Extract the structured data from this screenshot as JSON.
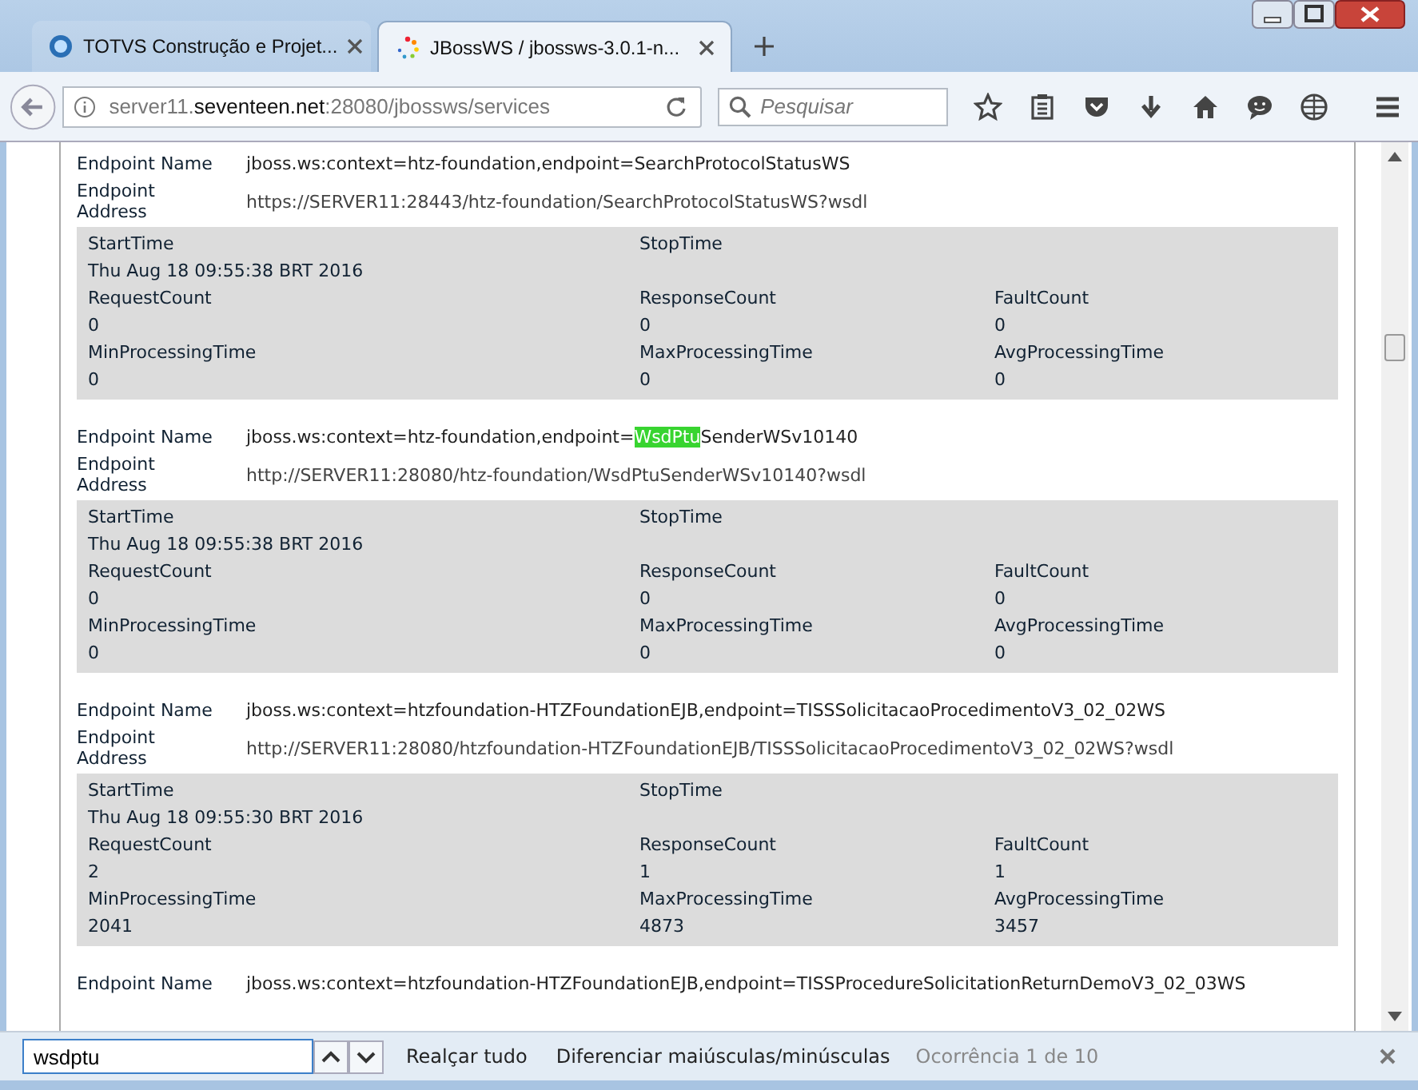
{
  "tabs": [
    {
      "label": "TOTVS Construção e Projet...",
      "selected": false
    },
    {
      "label": "JBossWS / jbossws-3.0.1-n...",
      "selected": true
    }
  ],
  "address": {
    "host_pre": "server11.",
    "host_bold": "seventeen.net",
    "rest": ":28080/jbossws/services"
  },
  "search": {
    "placeholder": "Pesquisar"
  },
  "endpoints": [
    {
      "name_label": "Endpoint Name",
      "name": [
        {
          "text": "jboss.ws:context=htz-foundation,endpoint=SearchProtocolStatusWS",
          "highlighted": false
        }
      ],
      "address_label": [
        "Endpoint",
        "Address"
      ],
      "address": "https://SERVER11:28443/htz-foundation/SearchProtocolStatusWS?wsdl",
      "stats": [
        [
          {
            "label": "StartTime",
            "value": "Thu Aug 18 09:55:38 BRT 2016"
          },
          {
            "label": "StopTime"
          }
        ],
        [
          {
            "label": "RequestCount",
            "value": "0"
          },
          {
            "label": "ResponseCount",
            "value": "0"
          },
          {
            "label": "FaultCount",
            "value": "0"
          }
        ],
        [
          {
            "label": "MinProcessingTime",
            "value": "0"
          },
          {
            "label": "MaxProcessingTime",
            "value": "0"
          },
          {
            "label": "AvgProcessingTime",
            "value": "0"
          }
        ]
      ]
    },
    {
      "name_label": "Endpoint Name",
      "name": [
        {
          "text": "jboss.ws:context=htz-foundation,endpoint=",
          "highlighted": false
        },
        {
          "text": "WsdPtu",
          "highlighted": true
        },
        {
          "text": "SenderWSv10140",
          "highlighted": false
        }
      ],
      "address_label": [
        "Endpoint",
        "Address"
      ],
      "address": "http://SERVER11:28080/htz-foundation/WsdPtuSenderWSv10140?wsdl",
      "stats": [
        [
          {
            "label": "StartTime",
            "value": "Thu Aug 18 09:55:38 BRT 2016"
          },
          {
            "label": "StopTime"
          }
        ],
        [
          {
            "label": "RequestCount",
            "value": "0"
          },
          {
            "label": "ResponseCount",
            "value": "0"
          },
          {
            "label": "FaultCount",
            "value": "0"
          }
        ],
        [
          {
            "label": "MinProcessingTime",
            "value": "0"
          },
          {
            "label": "MaxProcessingTime",
            "value": "0"
          },
          {
            "label": "AvgProcessingTime",
            "value": "0"
          }
        ]
      ]
    },
    {
      "name_label": "Endpoint Name",
      "name": [
        {
          "text": "jboss.ws:context=htzfoundation-HTZFoundationEJB,endpoint=TISSSolicitacaoProcedimentoV3_02_02WS",
          "highlighted": false
        }
      ],
      "address_label": [
        "Endpoint",
        "Address"
      ],
      "address": "http://SERVER11:28080/htzfoundation-HTZFoundationEJB/TISSSolicitacaoProcedimentoV3_02_02WS?wsdl",
      "stats": [
        [
          {
            "label": "StartTime",
            "value": "Thu Aug 18 09:55:30 BRT 2016"
          },
          {
            "label": "StopTime"
          }
        ],
        [
          {
            "label": "RequestCount",
            "value": "2"
          },
          {
            "label": "ResponseCount",
            "value": "1"
          },
          {
            "label": "FaultCount",
            "value": "1"
          }
        ],
        [
          {
            "label": "MinProcessingTime",
            "value": "2041"
          },
          {
            "label": "MaxProcessingTime",
            "value": "4873"
          },
          {
            "label": "AvgProcessingTime",
            "value": "3457"
          }
        ]
      ]
    },
    {
      "name_label": "Endpoint Name",
      "name": [
        {
          "text": "jboss.ws:context=htzfoundation-HTZFoundationEJB,endpoint=TISSProcedureSolicitationReturnDemoV3_02_03WS",
          "highlighted": false
        }
      ]
    }
  ],
  "find_bar": {
    "value": "wsdptu",
    "highlight_all": "Realçar tudo",
    "match_case": "Diferenciar maiúsculas/minúsculas",
    "status": "Ocorrência 1 de 10"
  }
}
